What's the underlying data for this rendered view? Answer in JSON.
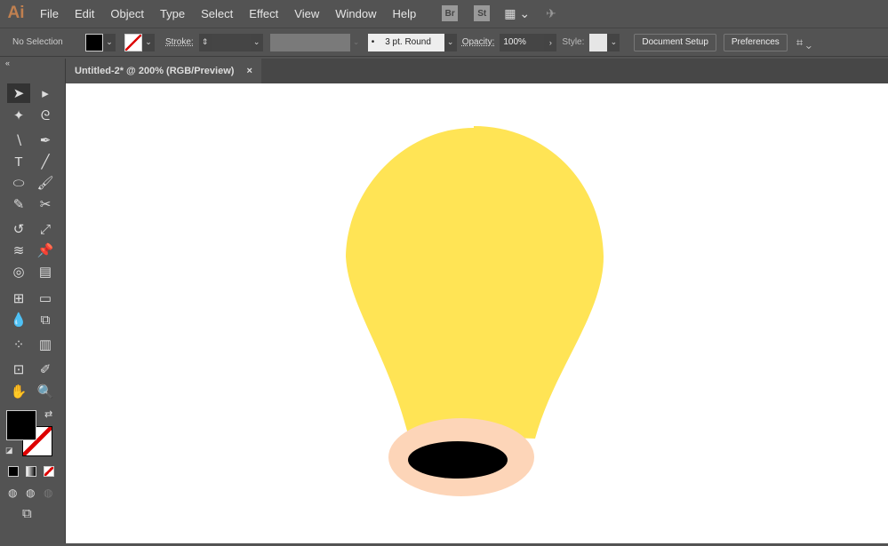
{
  "app": {
    "logo": "Ai",
    "menu": [
      "File",
      "Edit",
      "Object",
      "Type",
      "Select",
      "Effect",
      "View",
      "Window",
      "Help"
    ],
    "bridge": "Br",
    "stock": "St"
  },
  "control": {
    "selection": "No Selection",
    "stroke_label": "Stroke:",
    "brush": "3 pt. Round",
    "opacity_label": "Opacity:",
    "opacity": "100%",
    "style_label": "Style:",
    "document_setup": "Document Setup",
    "preferences": "Preferences"
  },
  "document": {
    "tab": "Untitled-2* @ 200% (RGB/Preview)",
    "close": "×"
  },
  "artwork": {
    "bulb_color": "#ffe455",
    "base_color": "#fdd5b8",
    "socket_color": "#000000"
  },
  "colors": {
    "fill": "#000000",
    "stroke": "none"
  }
}
